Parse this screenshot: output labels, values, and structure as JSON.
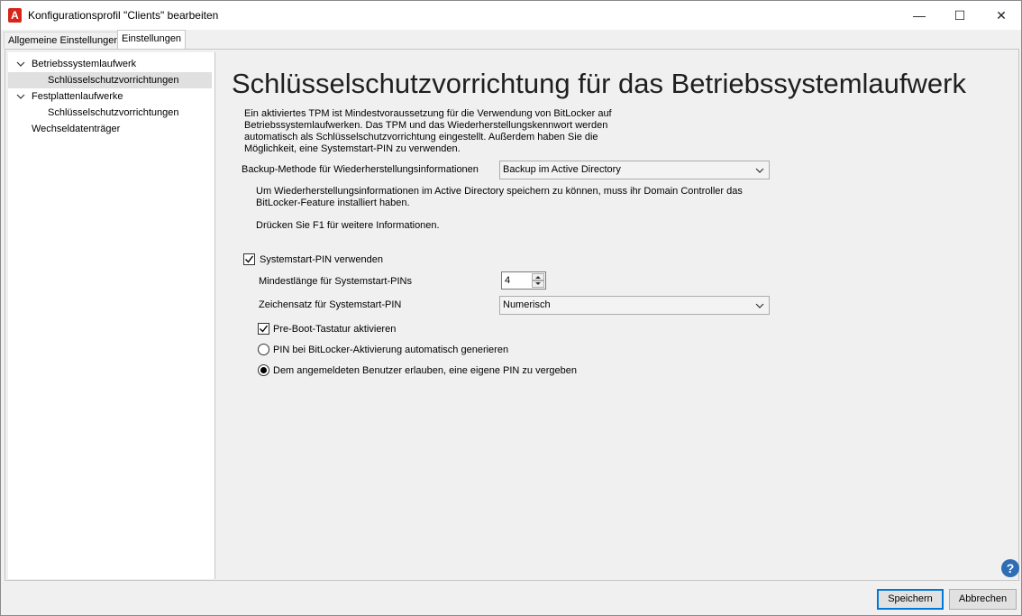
{
  "window": {
    "title": "Konfigurationsprofil \"Clients\" bearbeiten",
    "app_icon_glyph": "A",
    "minimize_glyph": "—",
    "maximize_glyph": "☐",
    "close_glyph": "✕"
  },
  "tabs": [
    {
      "label": "Allgemeine Einstellungen",
      "active": false
    },
    {
      "label": "Einstellungen",
      "active": true
    }
  ],
  "tree": [
    {
      "label": "Betriebssystemlaufwerk",
      "level": 0,
      "expanded": true,
      "selected": false
    },
    {
      "label": "Schlüsselschutzvorrichtungen",
      "level": 1,
      "selected": true
    },
    {
      "label": "Festplattenlaufwerke",
      "level": 0,
      "expanded": true,
      "selected": false
    },
    {
      "label": "Schlüsselschutzvorrichtungen",
      "level": 1,
      "selected": false
    },
    {
      "label": "Wechseldatenträger",
      "level": 0,
      "selected": false
    }
  ],
  "main": {
    "heading": "Schlüsselschutzvorrichtung für das Betriebssystemlaufwerk",
    "intro": "Ein aktiviertes TPM ist Mindestvoraussetzung für die Verwendung von BitLocker auf Betriebssystemlaufwerken. Das TPM und das Wiederherstellungskennwort werden automatisch als Schlüsselschutzvorrichtung eingestellt. Außerdem haben Sie die Möglichkeit, eine Systemstart-PIN zu verwenden.",
    "backup_label": "Backup-Methode für Wiederherstellungsinformationen",
    "backup_value": "Backup im Active Directory",
    "backup_note": "Um Wiederherstellungsinformationen im Active Directory speichern zu können, muss ihr Domain Controller das BitLocker-Feature installiert haben.",
    "f1_hint": "Drücken Sie F1 für weitere Informationen.",
    "pin_checkbox_label": "Systemstart-PIN verwenden",
    "pin_checkbox_checked": true,
    "min_length_label": "Mindestlänge für Systemstart-PINs",
    "min_length_value": "4",
    "charset_label": "Zeichensatz für Systemstart-PIN",
    "charset_value": "Numerisch",
    "preboot_label": "Pre-Boot-Tastatur aktivieren",
    "preboot_checked": true,
    "radio_auto_label": "PIN bei BitLocker-Aktivierung automatisch generieren",
    "radio_user_label": "Dem angemeldeten Benutzer erlauben, eine eigene PIN zu vergeben",
    "selected_radio": "user"
  },
  "help_glyph": "?",
  "footer": {
    "save_label": "Speichern",
    "cancel_label": "Abbrechen"
  },
  "colors": {
    "accent": "#0078d7",
    "app_icon": "#d6251b",
    "help_icon": "#2e6db4"
  }
}
